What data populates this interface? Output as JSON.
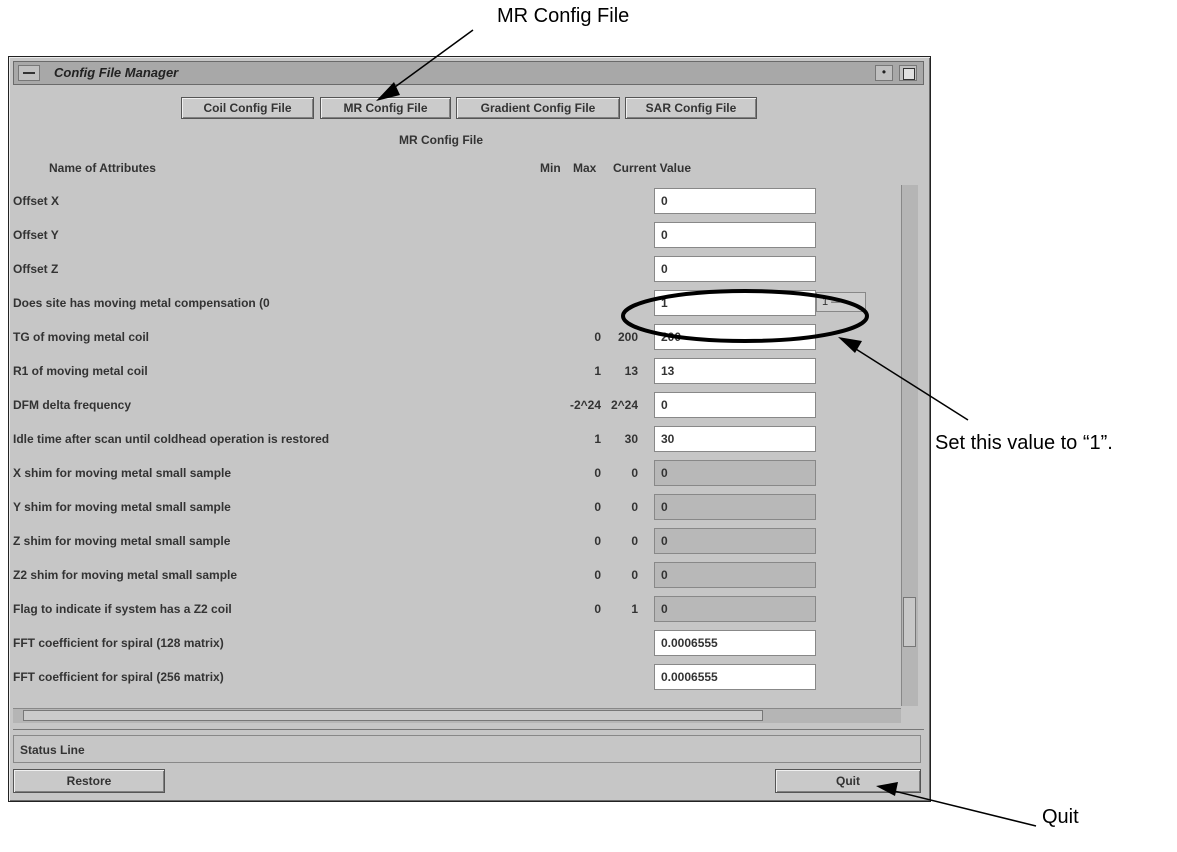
{
  "callouts": {
    "mr_config_file": "MR Config File",
    "set_value": "Set this value to “1”.",
    "quit": "Quit"
  },
  "window": {
    "title": "Config File Manager",
    "minimize_glyph": "•"
  },
  "tabs": [
    {
      "label": "Coil Config File"
    },
    {
      "label": "MR Config File"
    },
    {
      "label": "Gradient Config File"
    },
    {
      "label": "SAR Config File"
    }
  ],
  "section_title": "MR Config File",
  "columns": {
    "name": "Name of Attributes",
    "min": "Min",
    "max": "Max",
    "current": "Current Value"
  },
  "rows": [
    {
      "name": "Offset X",
      "min": "",
      "max": "",
      "value": "0",
      "editable": true
    },
    {
      "name": "Offset Y",
      "min": "",
      "max": "",
      "value": "0",
      "editable": true
    },
    {
      "name": "Offset Z",
      "min": "",
      "max": "",
      "value": "0",
      "editable": true
    },
    {
      "name": "Does site has moving metal compensation (0",
      "min": "",
      "max": "",
      "value": "1",
      "editable": true,
      "option": "1 —"
    },
    {
      "name": "TG of moving metal coil",
      "min": "0",
      "max": "200",
      "value": "200",
      "editable": true
    },
    {
      "name": "R1 of moving metal coil",
      "min": "1",
      "max": "13",
      "value": "13",
      "editable": true
    },
    {
      "name": "DFM delta frequency",
      "min": "-2^24",
      "max": "2^24",
      "value": "0",
      "editable": true
    },
    {
      "name": "Idle time after scan until coldhead operation is restored",
      "min": "1",
      "max": "30",
      "value": "30",
      "editable": true
    },
    {
      "name": "X shim for moving metal small sample",
      "min": "0",
      "max": "0",
      "value": "0",
      "editable": false
    },
    {
      "name": "Y shim for moving metal small sample",
      "min": "0",
      "max": "0",
      "value": "0",
      "editable": false
    },
    {
      "name": "Z shim for moving metal small sample",
      "min": "0",
      "max": "0",
      "value": "0",
      "editable": false
    },
    {
      "name": "Z2 shim for moving metal small sample",
      "min": "0",
      "max": "0",
      "value": "0",
      "editable": false
    },
    {
      "name": "Flag to indicate if system has a Z2 coil",
      "min": "0",
      "max": "1",
      "value": "0",
      "editable": false
    },
    {
      "name": "FFT coefficient for spiral (128 matrix)",
      "min": "",
      "max": "",
      "value": "0.0006555",
      "editable": true
    },
    {
      "name": "FFT coefficient for spiral (256 matrix)",
      "min": "",
      "max": "",
      "value": "0.0006555",
      "editable": true
    }
  ],
  "status_line": "Status Line",
  "buttons": {
    "restore": "Restore",
    "quit": "Quit"
  }
}
